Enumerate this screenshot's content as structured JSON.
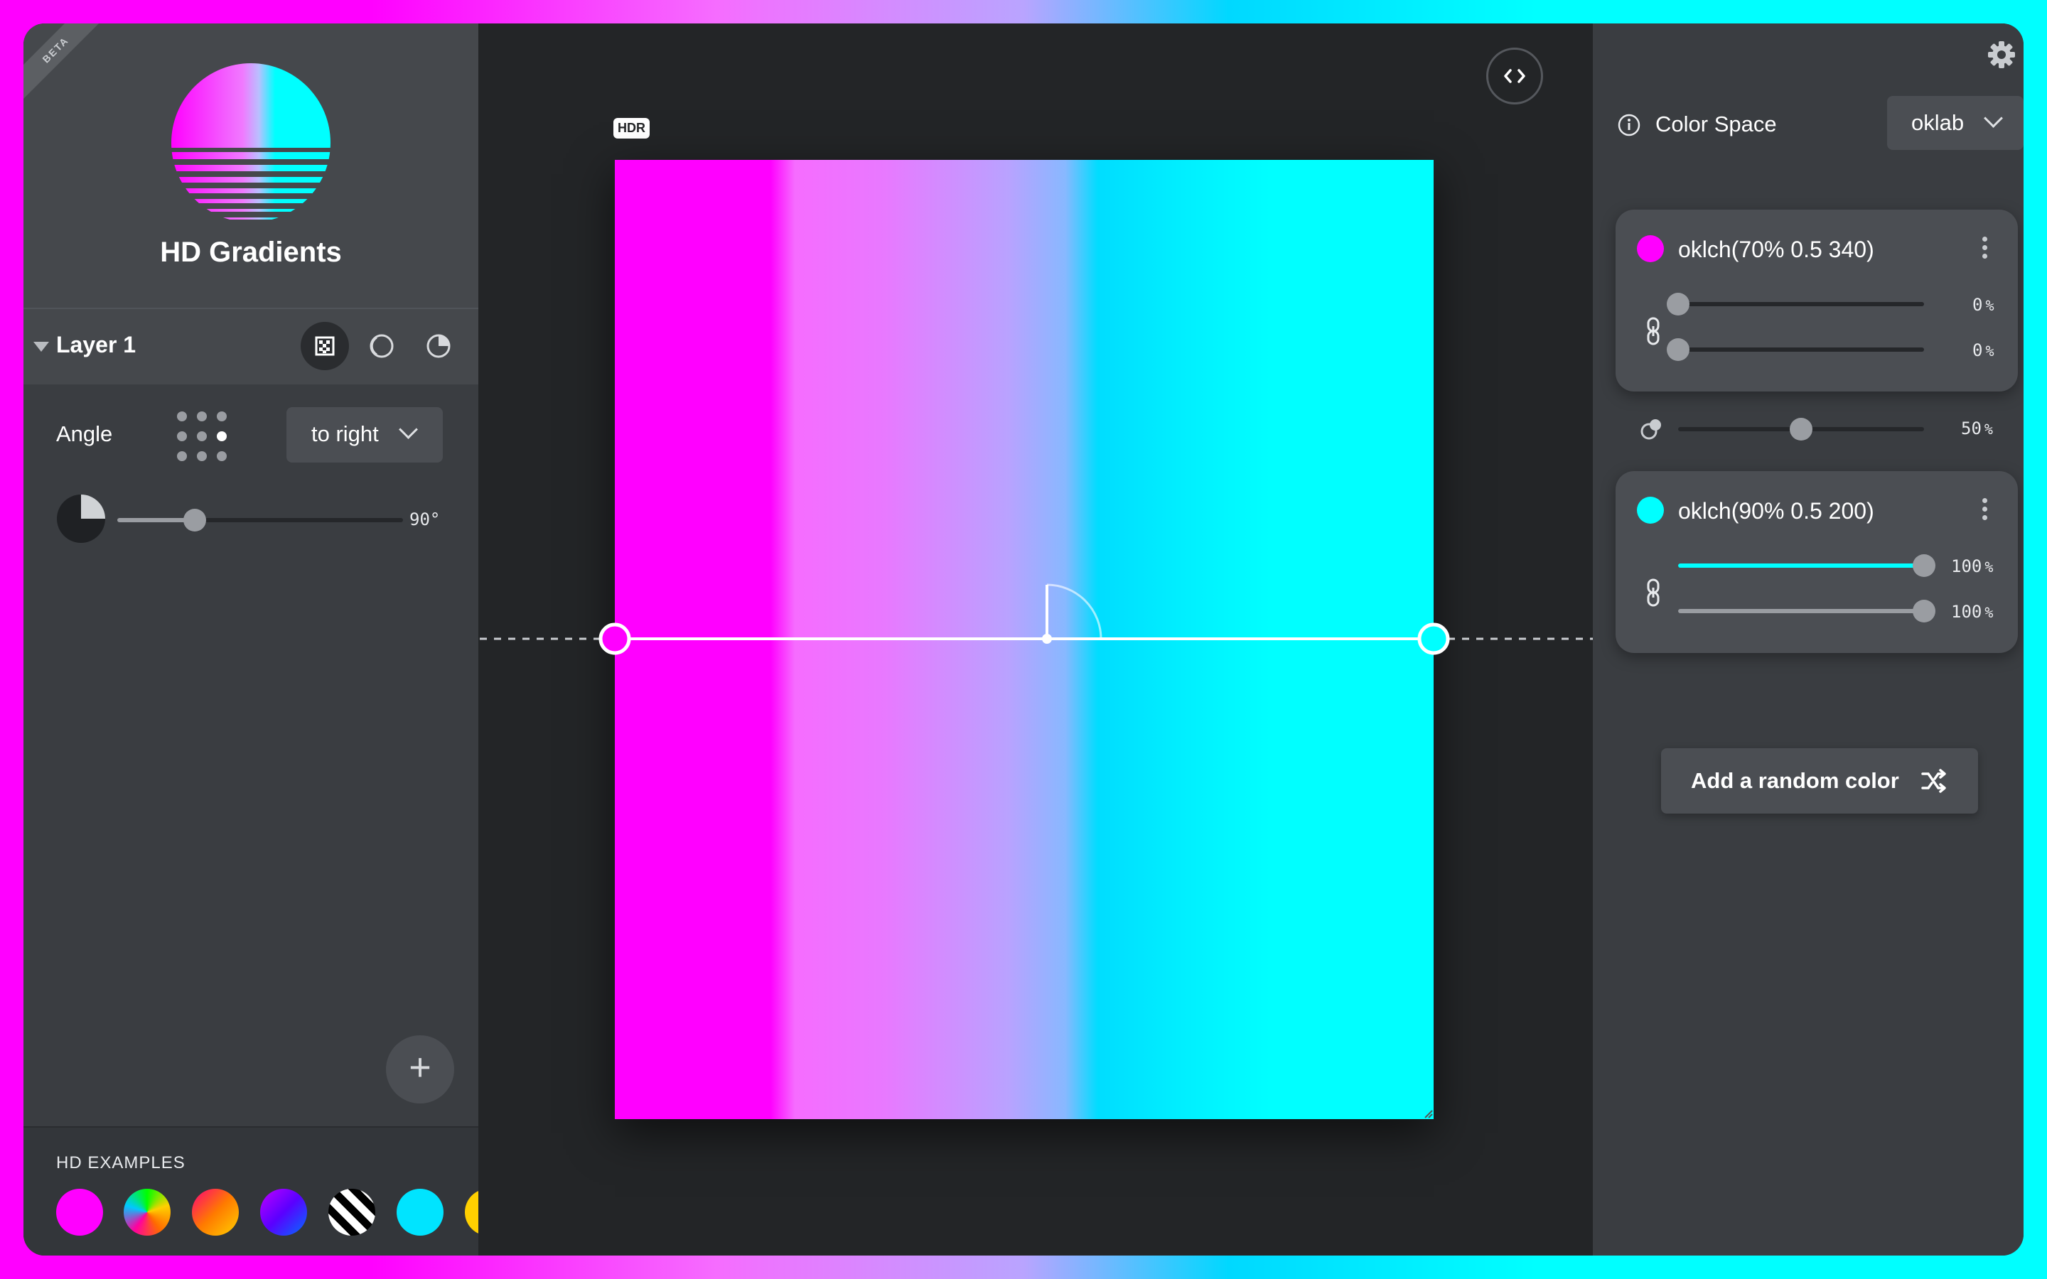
{
  "brand": {
    "title": "HD Gradients",
    "badge": "BETA"
  },
  "layer": {
    "name": "Layer 1"
  },
  "angle": {
    "label": "Angle",
    "direction": "to right",
    "value": "90",
    "unit": "°",
    "fraction": 0.27
  },
  "examples": {
    "label": "HD EXAMPLES",
    "swatches": [
      "magenta-swatch",
      "rainbow-swatch",
      "sunset-swatch",
      "violet-blue-swatch",
      "stripes-swatch",
      "cyan-swatch",
      "yellow-swatch"
    ]
  },
  "canvas": {
    "hdr_badge": "HDR"
  },
  "color_space": {
    "label": "Color Space",
    "value": "oklab"
  },
  "stops": [
    {
      "label": "oklch(70% 0.5 340)",
      "color": "#ff00ff",
      "pos_start": "0",
      "pos_end": "0",
      "pos_start_fraction": 0.0,
      "pos_end_fraction": 0.0
    },
    {
      "label": "oklch(90% 0.5 200)",
      "color": "#00ffff",
      "pos_start": "100",
      "pos_end": "100",
      "pos_start_fraction": 1.0,
      "pos_end_fraction": 1.0
    }
  ],
  "midpoint": {
    "value": "50",
    "fraction": 0.5
  },
  "percent_unit": "%",
  "random_button": {
    "label": "Add a random color"
  },
  "colors": {
    "accent_cyan": "#00ffff",
    "accent_magenta": "#ff00ff",
    "panel": "#3a3d41",
    "canvas_bg": "#232527"
  }
}
